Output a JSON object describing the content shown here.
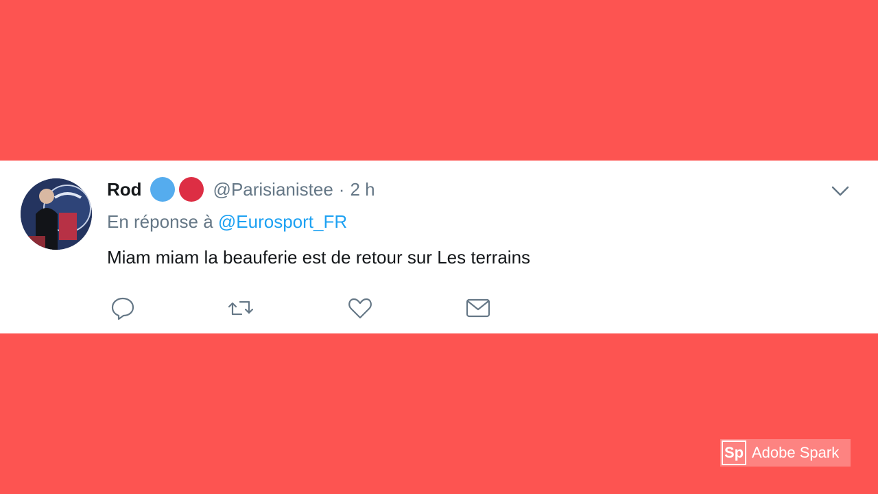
{
  "tweet": {
    "display_name": "Rod",
    "handle": "@Parisianistee",
    "separator": "·",
    "time": "2 h",
    "reply_prefix": "En réponse à",
    "reply_to": "@Eurosport_FR",
    "text": "Miam miam la beauferie est de retour sur Les terrains",
    "emoji": [
      {
        "name": "blue-circle-emoji",
        "color": "#55acee"
      },
      {
        "name": "red-circle-emoji",
        "color": "#dd2e44"
      }
    ],
    "actions": [
      "reply-icon",
      "retweet-icon",
      "like-icon",
      "direct-message-icon"
    ],
    "menu_icon": "chevron-down-icon"
  },
  "watermark": {
    "logo": "Sp",
    "label": "Adobe Spark"
  },
  "colors": {
    "background": "#fd5451",
    "card": "#ffffff",
    "text": "#14171a",
    "secondary_text": "#657786",
    "link": "#1da1f2",
    "icon": "#657786"
  }
}
